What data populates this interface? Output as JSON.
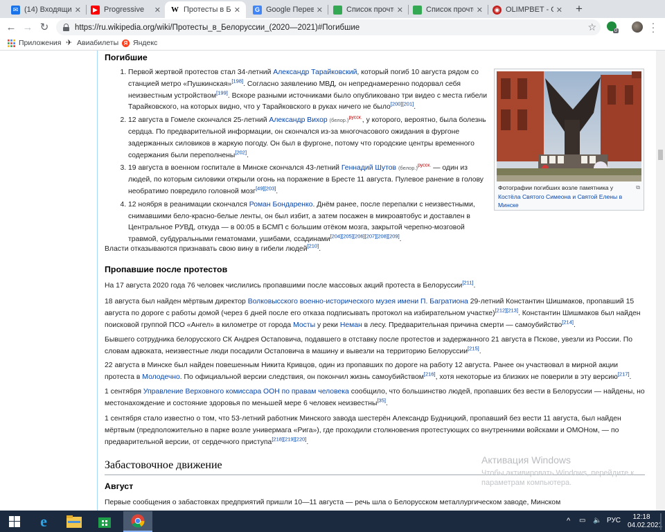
{
  "tabs": [
    {
      "title": "(14) Входящие",
      "favicon": "mail-icon",
      "color": "#1a73e8"
    },
    {
      "title": "Progressive",
      "favicon": "youtube-icon",
      "color": "#ff0000"
    },
    {
      "title": "Протесты в Бело",
      "favicon": "wikipedia-icon",
      "color": "#ffffff",
      "active": true
    },
    {
      "title": "Google Перевод",
      "favicon": "google-translate-icon",
      "color": "#4285f4"
    },
    {
      "title": "Список прочтен",
      "favicon": "sheets-icon",
      "color": "#34a853"
    },
    {
      "title": "Список прочтен",
      "favicon": "sheets-icon",
      "color": "#34a853"
    },
    {
      "title": "OLIMPBET - Спо",
      "favicon": "olimpbet-icon",
      "color": "#c5221f"
    }
  ],
  "address": {
    "url": "https://ru.wikipedia.org/wiki/Протесты_в_Белоруссии_(2020—2021)#Погибшие"
  },
  "bookmarks": [
    {
      "label": "Приложения",
      "icon": "apps-grid-icon"
    },
    {
      "label": "Авиабилеты",
      "icon": "airplane-icon"
    },
    {
      "label": "Яндекс",
      "icon": "yandex-icon"
    }
  ],
  "article": {
    "h_killed": "Погибшие",
    "victims": [
      {
        "t1": "Первой жертвой протестов стал 34-летний ",
        "l1": "Александр Тарайковский",
        "t2": ", который погиб 10 августа рядом со станцией метро «Пушкинская»",
        "r1": "[198]",
        "t3": ". Согласно заявлению МВД, он непреднамеренно подорвал себя неизвестным устройством",
        "r2": "[199]",
        "t4": ". Вскоре разными источниками было опубликовано три видео с места гибели Тарайковского, на которых видно, что у Тарайковского в руках ничего не было",
        "r3": "[200][201]",
        "t5": "."
      },
      {
        "t1": "12 августа в Гомеле скончался 25-летний ",
        "l1": "Александр Вихор",
        "lang_sub": "(белор.)",
        "lang_sup": "русск.",
        "t2": ", у которого, вероятно, была болезнь сердца. По предварительной информации, он скончался из-за многочасового ожидания в фургоне задержанных силовиков в жаркую погоду. Он был в фургоне, потому что городские центры временного содержания были переполнены",
        "r1": "[202]",
        "t3": "."
      },
      {
        "t1": "19 августа в военном госпитале в Минске скончался 43-летний ",
        "l1": "Геннадий Шутов",
        "lang_sub": "(белор.)",
        "lang_sup": "русск.",
        "t2": " — один из людей, по которым силовики открыли огонь на поражение в Бресте 11 августа. Пулевое ранение в голову необратимо повредило головной мозг",
        "r1": "[49][203]",
        "t3": "."
      },
      {
        "t1": "12 ноября в реанимации скончался ",
        "l1": "Роман Бондаренко",
        "t2": ". Днём ранее, после перепалки с неизвестными, снимавшими бело-красно-белые ленты, он был избит, а затем посажен в микроавтобус и доставлен в Центральное РУВД, откуда — в 00:05 в БСМП с большим отёком мозга, закрытой черепно-мозговой травмой, субдуральными гематомами, ушибами, ссадинами",
        "r1": "[204][205][206][207][208][209]",
        "t3": "."
      }
    ],
    "authorities": {
      "t1": "Власти отказываются признавать свою вину в гибели людей",
      "r1": "[210]",
      "t2": "."
    },
    "thumb_caption": {
      "t1": "Фотографии погибших возле памятника у ",
      "l1": "Костёла Святого Симеона и Святой Елены в Минске"
    },
    "h_missing": "Пропавшие после протестов",
    "m1": {
      "t1": "На 17 августа 2020 года 76 человек числились пропавшими после массовых акций протеста в Белоруссии",
      "r1": "[211]",
      "t2": "."
    },
    "m2": {
      "t1": "18 августа был найден мёртвым директор ",
      "l1": "Волковысского военно-исторического музея имени П. Багратиона",
      "t2": " 29-летний Константин Шишмаков, пропавший 15 августа по дороге с работы домой (через 6 дней после его отказа подписывать протокол на избирательном участке)",
      "r1": "[212][213]",
      "t3": ". Константин Шишмаков был найден поисковой группой ПСО «Ангел» в километре от города ",
      "l2": "Мосты",
      "t4": " у реки ",
      "l3": "Неман",
      "t5": " в лесу. Предварительная причина смерти — самоубийство",
      "r2": "[214]",
      "t6": "."
    },
    "m3": {
      "t1": "Бывшего сотрудника белорусского СК Андрея Остаповича, подавшего в отставку после протестов и задержанного 21 августа в Пскове, увезли из России. По словам адвоката, неизвестные люди посадили Остаповича в машину и вывезли на территорию Белоруссии",
      "r1": "[215]",
      "t2": "."
    },
    "m4": {
      "t1": "22 августа в Минске был найден повешенным Никита Кривцов, один из пропавших по дороге на работу 12 августа. Ранее он участвовал в мирной акции протеста в ",
      "l1": "Молодечно",
      "t2": ". По официальной версии следствия, он покончил жизнь самоубийством",
      "r1": "[216]",
      "t3": ", хотя некоторые из близких не поверили в эту версию",
      "r2": "[217]",
      "t4": "."
    },
    "m5": {
      "t1": "1 сентября ",
      "l1": "Управление Верховного комиссара ООН по правам человека",
      "t2": " сообщило, что большинство людей, пропавших без вести в Белоруссии — найдены, но местонахождение и состояние здоровья по меньшей мере 6 человек неизвестны",
      "r1": "[35]",
      "t3": "."
    },
    "m6": {
      "t1": "1 сентября стало известно о том, что 53-летний работник Минского завода шестерён Александр Будницкий, пропавший без вести 11 августа, был найден мёртвым (предположительно в парке возле универмага «Рига»), где проходили столкновения протестующих со внутренними войсками и ОМОНом, — по предварительной версии, от сердечного приступа",
      "r1": "[218][219][220]",
      "t2": "."
    },
    "h_strike": "Забастовочное движение",
    "h_august": "Август",
    "strike_p": "Первые сообщения о забастовках предприятий пришли 10—11 августа — речь шла о Белорусском металлургическом заводе, Минском"
  },
  "watermark": {
    "title": "Активация Windows",
    "line1": "Чтобы активировать Windows, перейдите к",
    "line2": "параметрам компьютера."
  },
  "taskbar": {
    "lang": "РУС",
    "time": "12:18",
    "date": "04.02.2021"
  }
}
